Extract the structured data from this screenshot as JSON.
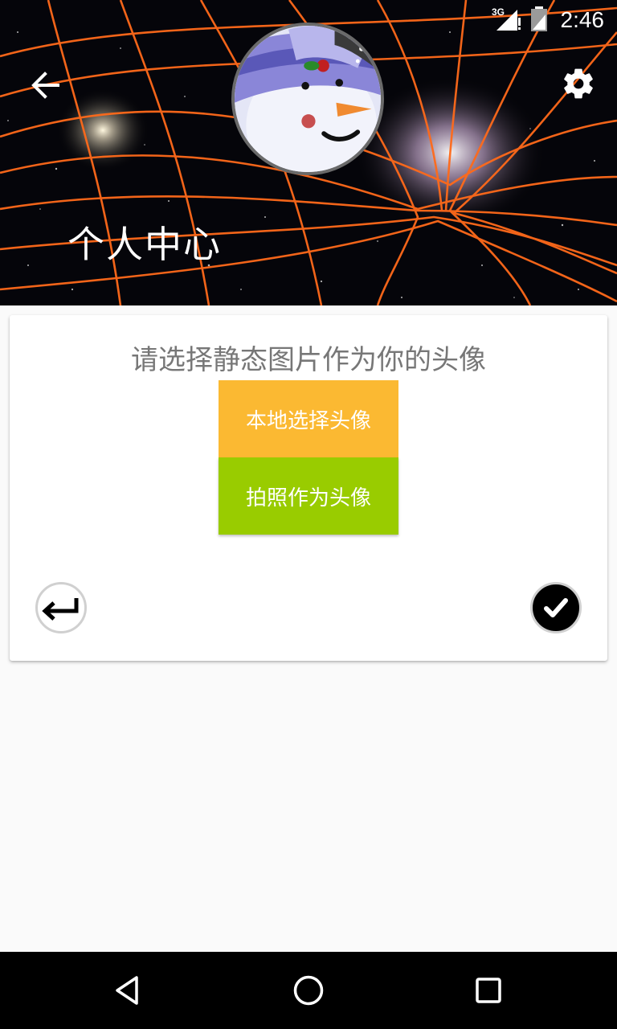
{
  "status_bar": {
    "network": "3G",
    "time": "2:46"
  },
  "header": {
    "title": "个人中心",
    "back_icon": "arrow-left-icon",
    "settings_icon": "gear-icon",
    "avatar_description": "snowman-avatar"
  },
  "dialog": {
    "prompt": "请选择静态图片作为你的头像",
    "options": [
      {
        "label": "本地选择头像",
        "color": "#fbb932"
      },
      {
        "label": "拍照作为头像",
        "color": "#99cc00"
      }
    ],
    "cancel_icon": "return-arrow-icon",
    "confirm_icon": "checkmark-icon"
  },
  "nav_bar": {
    "back_icon": "triangle-back-icon",
    "home_icon": "circle-home-icon",
    "recents_icon": "square-recents-icon"
  },
  "colors": {
    "grid_lines": "#ff6a1a",
    "option_local": "#fbb932",
    "option_camera": "#99cc00",
    "prompt_text": "#777777"
  }
}
